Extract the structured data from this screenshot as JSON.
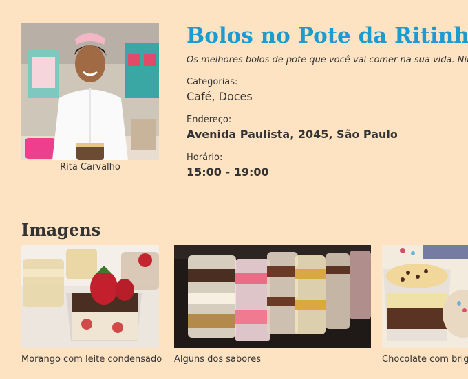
{
  "profile": {
    "photo_icon": "person-photo",
    "name": "Rita Carvalho"
  },
  "store": {
    "title": "Bolos no Pote da Ritinha",
    "slogan": "Os melhores bolos de pote que você vai comer na sua vida. Nin",
    "categories_label": "Categorias:",
    "categories_value": "Café, Doces",
    "address_label": "Endereço:",
    "address_value": "Avenida Paulista, 2045, São Paulo",
    "hours_label": "Horário:",
    "hours_value": "15:00 - 19:00"
  },
  "images": {
    "heading": "Imagens",
    "items": [
      {
        "caption": "Morango com leite condensado"
      },
      {
        "caption": "Alguns dos sabores"
      },
      {
        "caption": "Chocolate com brig"
      }
    ]
  },
  "colors": {
    "background": "#fde3c2",
    "title": "#1d9bd1",
    "text": "#333333"
  }
}
